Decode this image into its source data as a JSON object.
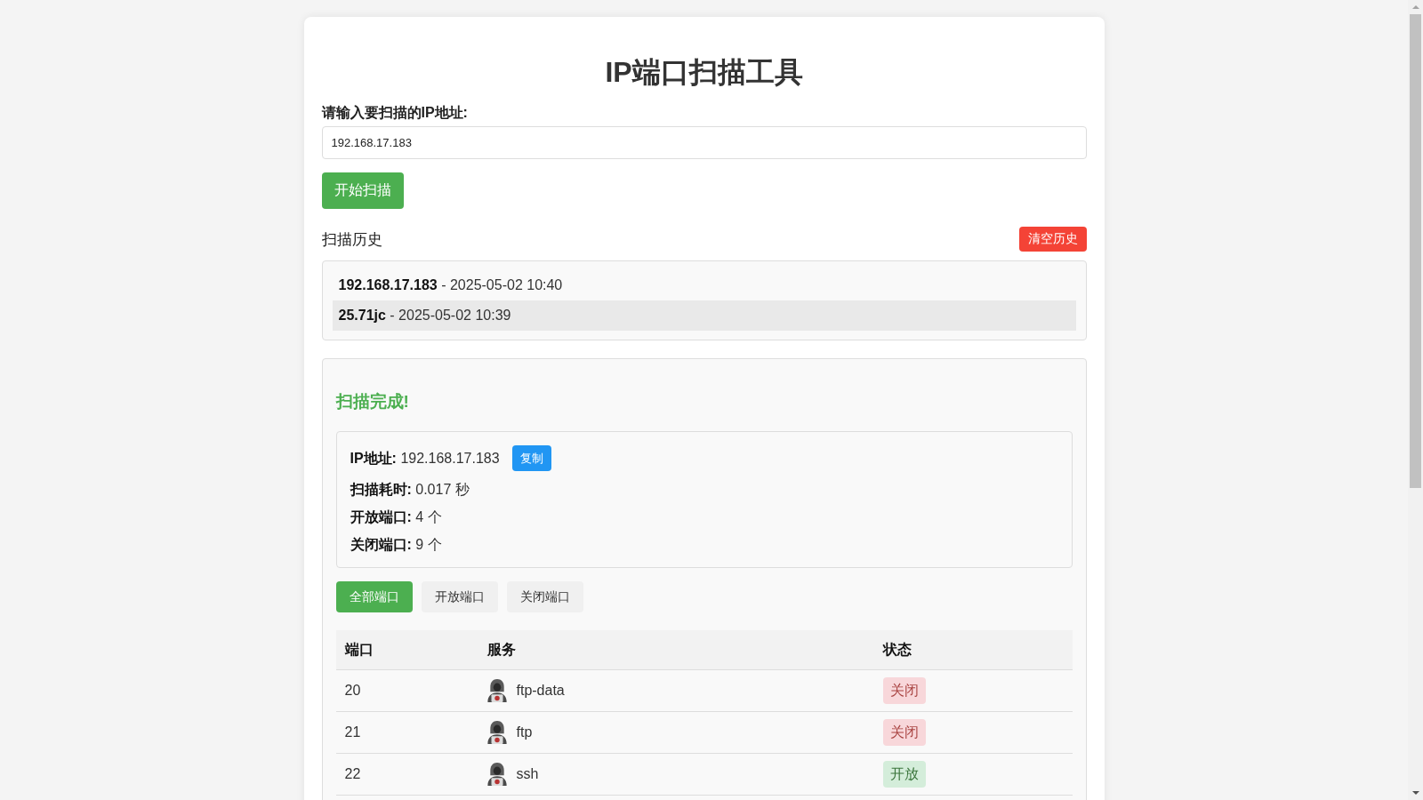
{
  "app": {
    "title": "IP端口扫描工具"
  },
  "ip_form": {
    "label": "请输入要扫描的IP地址:",
    "value": "192.168.17.183",
    "submit_button": "开始扫描"
  },
  "history": {
    "title": "扫描历史",
    "clear_button": "清空历史",
    "items": [
      {
        "text": "**192.168.17.183** - 2025-05-02 10:40",
        "hovered": false
      },
      {
        "text": "**25.71jc** - 2025-05-02 10:39",
        "hovered": true
      }
    ]
  },
  "result": {
    "status": "扫描完成!",
    "summary": [
      {
        "text": "**IP地址:** 192.168.17.183",
        "copy_button": "复制"
      },
      {
        "text": "**扫描耗时:** 0.017 秒"
      },
      {
        "text": "**开放端口:** 4 个"
      },
      {
        "text": "**关闭端口:** 9 个"
      }
    ],
    "filters": [
      {
        "label": "全部端口",
        "selected": true
      },
      {
        "label": "开放端口",
        "selected": false
      },
      {
        "label": "关闭端口",
        "selected": false
      }
    ],
    "table": {
      "columns": [
        "端口",
        "服务",
        "状态"
      ],
      "rows": [
        {
          "port": "20",
          "service": "ftp-data",
          "status": "关闭",
          "open": false
        },
        {
          "port": "21",
          "service": "ftp",
          "status": "关闭",
          "open": false
        },
        {
          "port": "22",
          "service": "ssh",
          "status": "开放",
          "open": true
        }
      ]
    }
  }
}
